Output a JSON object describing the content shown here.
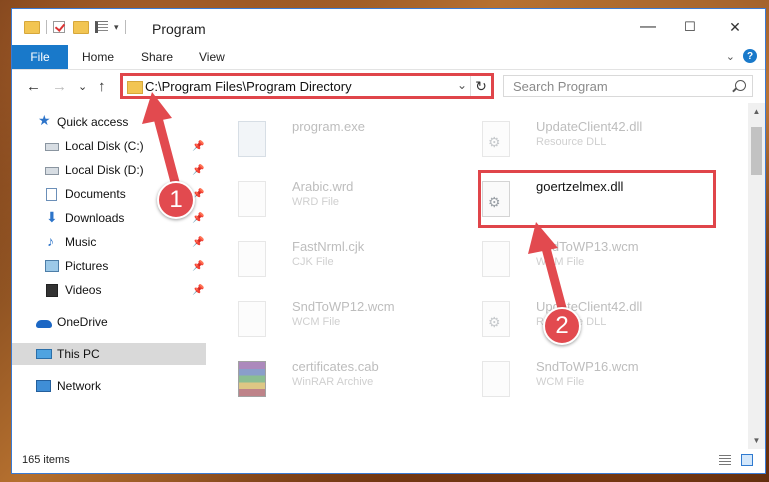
{
  "titlebar": {
    "title": "Program",
    "minimize": "—",
    "maximize": "☐",
    "close": "✕"
  },
  "ribbon": {
    "tabs": [
      "File",
      "Home",
      "Share",
      "View"
    ],
    "expand": "⌄",
    "help": "?"
  },
  "nav": {
    "back": "←",
    "forward": "→",
    "recent": "⌄",
    "up": "↑",
    "address": "C:\\Program Files\\Program Directory",
    "address_dropdown": "⌄",
    "refresh": "↻",
    "search_placeholder": "Search Program"
  },
  "sidebar": {
    "items": [
      {
        "label": "Quick access",
        "icon": "star-icon"
      },
      {
        "label": "Local Disk (C:)",
        "icon": "disk-icon",
        "pinned": true
      },
      {
        "label": "Local Disk (D:)",
        "icon": "disk-icon",
        "pinned": true
      },
      {
        "label": "Documents",
        "icon": "documents-icon",
        "pinned": true
      },
      {
        "label": "Downloads",
        "icon": "downloads-icon",
        "pinned": true
      },
      {
        "label": "Music",
        "icon": "music-icon",
        "pinned": true
      },
      {
        "label": "Pictures",
        "icon": "pictures-icon",
        "pinned": true
      },
      {
        "label": "Videos",
        "icon": "videos-icon",
        "pinned": true
      },
      {
        "label": "OneDrive",
        "icon": "onedrive-icon"
      },
      {
        "label": "This PC",
        "icon": "this-pc-icon",
        "selected": true
      },
      {
        "label": "Network",
        "icon": "network-icon"
      }
    ]
  },
  "files": [
    {
      "name": "program.exe",
      "type": ""
    },
    {
      "name": "UpdateClient42.dll",
      "type": "Resource DLL"
    },
    {
      "name": "Arabic.wrd",
      "type": "WRD File"
    },
    {
      "name": "goertzelmex.dll",
      "type": ""
    },
    {
      "name": "FastNrml.cjk",
      "type": "CJK File"
    },
    {
      "name": "SndToWP13.wcm",
      "type": "WCM File"
    },
    {
      "name": "SndToWP12.wcm",
      "type": "WCM File"
    },
    {
      "name": "UpdateClient42.dll",
      "type": "Resource DLL"
    },
    {
      "name": "certificates.cab",
      "type": "WinRAR Archive"
    },
    {
      "name": "SndToWP16.wcm",
      "type": "WCM File"
    }
  ],
  "callouts": [
    "1",
    "2"
  ],
  "status": {
    "items_count": "165 items"
  },
  "colors": {
    "accent": "#1979ca",
    "highlight": "#e0454a"
  }
}
